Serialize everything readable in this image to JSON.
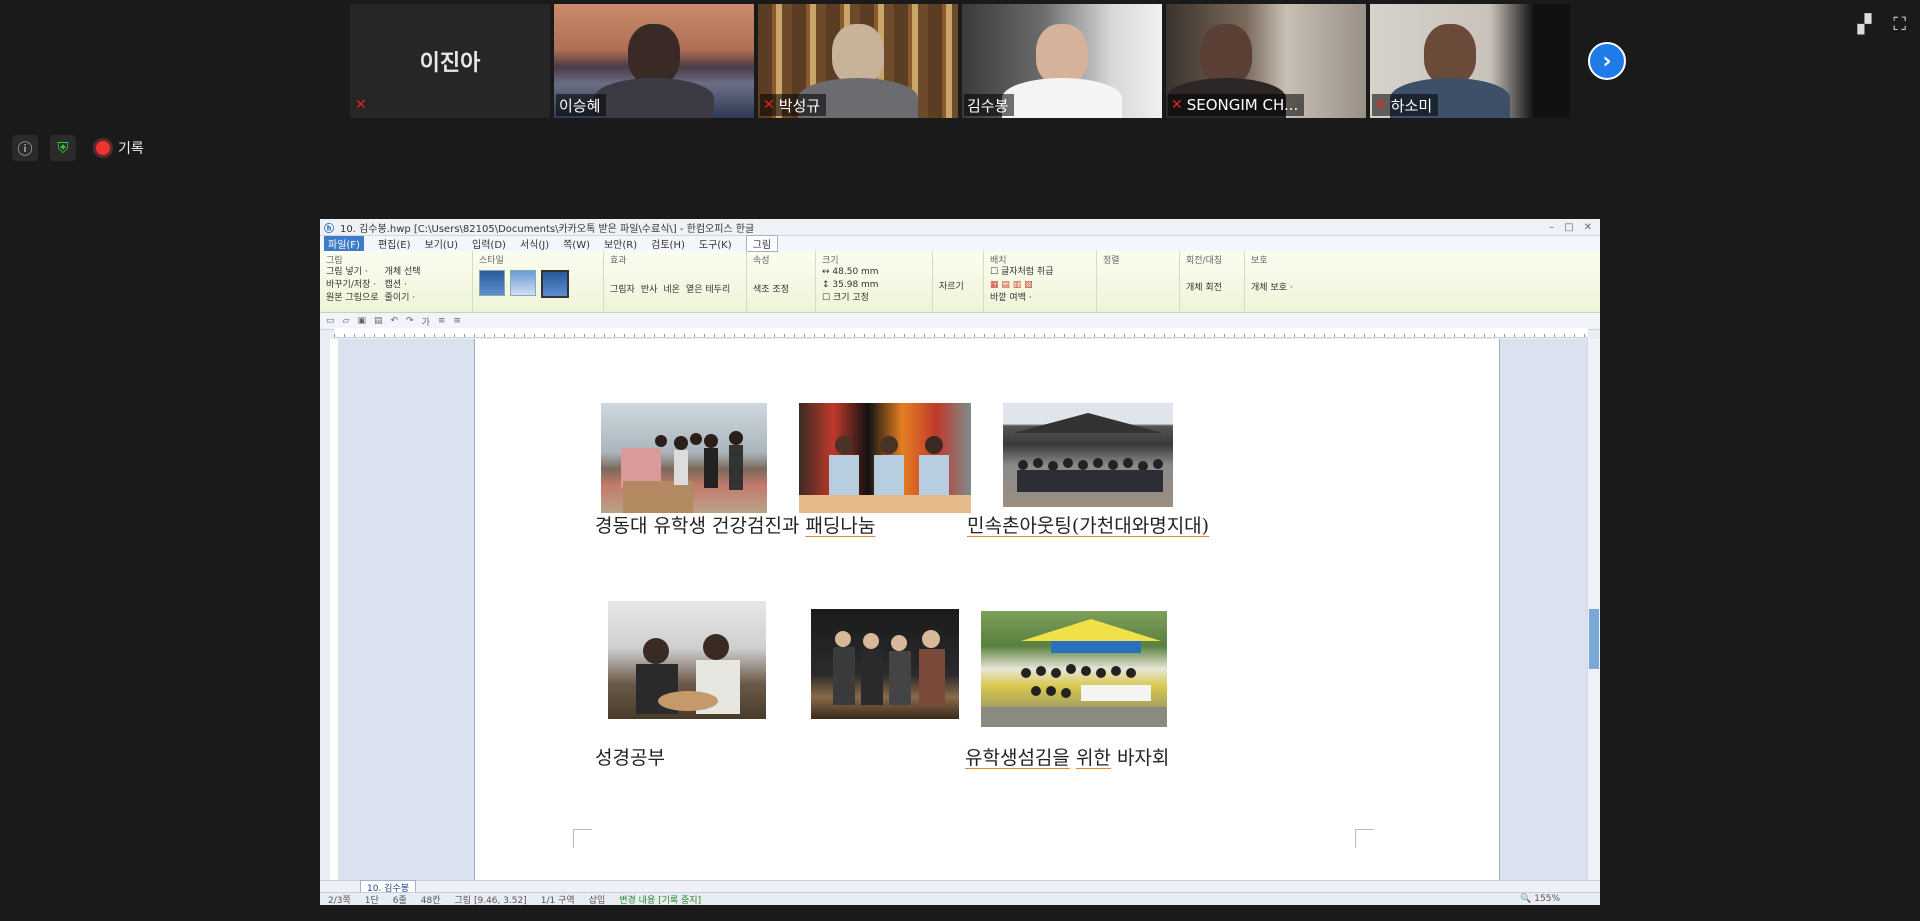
{
  "participants": [
    {
      "name": "이진아",
      "muted": true,
      "video": false
    },
    {
      "name": "이승혜",
      "muted": false,
      "video": true
    },
    {
      "name": "박성규",
      "muted": true,
      "video": true
    },
    {
      "name": "김수봉",
      "muted": false,
      "video": true,
      "active": true
    },
    {
      "name": "SEONGIM CH...",
      "muted": true,
      "video": true
    },
    {
      "name": "하소미",
      "muted": true,
      "video": true
    }
  ],
  "meeting": {
    "record_label": "기록",
    "next_icon": "chevron-right-icon"
  },
  "hwp": {
    "title": "10. 김수봉.hwp  [C:\\Users\\82105\\Documents\\카카오톡 받은 파일\\수료식\\]  - 한컴오피스 한글",
    "menu": [
      "파일(F)",
      "편집(E)",
      "보기(U)",
      "입력(D)",
      "서식(J)",
      "쪽(W)",
      "보안(R)",
      "검토(H)",
      "도구(K)",
      "그림"
    ],
    "ribbon": {
      "group1_label": "그림",
      "group1_items": [
        "그림 넣기 ·",
        "바꾸기/저장 ·",
        "원본 그림으로",
        "개체 선택",
        "캡션 ·",
        "줄이기 ·"
      ],
      "style_label": "스타일",
      "effect_label": "효과",
      "effect_items": [
        "그림자",
        "반사",
        "네온",
        "옅은 테두리"
      ],
      "prop_label": "속성",
      "prop_items": [
        "색조 조정"
      ],
      "size_label": "크기",
      "size_w": "48.50 mm",
      "size_h": "35.98 mm",
      "size_fix": "크기 고정",
      "crop_label": "자르기",
      "arrange_label": "배치",
      "arrange_items": [
        "글자처럼 취급",
        "바깥 여백 ·"
      ],
      "align_label": "정렬",
      "rotate_label": "회전/대칭",
      "rotate_items": [
        "개체 회전"
      ],
      "protect_label": "보호",
      "protect_items": [
        "개체 보호 ·"
      ]
    },
    "tab_name": "10. 김수봉",
    "status": [
      "2/3쪽",
      "1단",
      "6줄",
      "48칸",
      "그림 [9.46, 3.52]",
      "1/1 구역",
      "삽입",
      "변경 내용 [기록 중지]"
    ],
    "zoom": "155%"
  },
  "document": {
    "captions": {
      "row1_left_a": "경동대",
      "row1_left_b": "유학생",
      "row1_left_c": "건강검진과",
      "row1_mid": "패딩나눔",
      "row1_right": "민속촌아웃팅(가천대와명지대)",
      "row2_left": "성경공부",
      "row2_right_a": "유학생섬김을",
      "row2_right_b": "위한",
      "row2_right_c": "바자회"
    },
    "photos": [
      "padding-donation-photo",
      "health-check-photo",
      "folk-village-group-photo",
      "bible-study-cafe-photo",
      "group-standing-photo",
      "bazaar-tent-photo"
    ]
  }
}
